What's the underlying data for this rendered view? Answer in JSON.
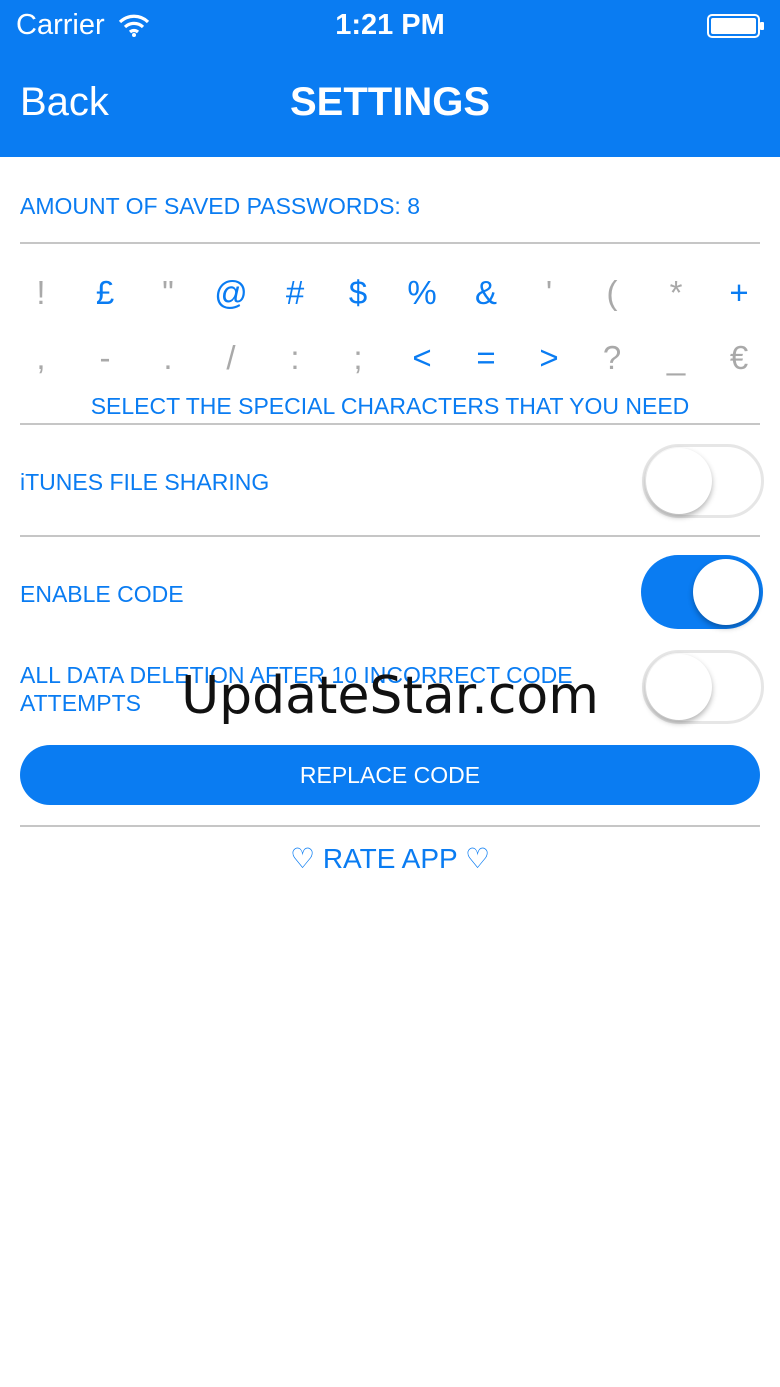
{
  "status_bar": {
    "carrier": "Carrier",
    "time": "1:21 PM",
    "icons": [
      "wifi-icon",
      "battery-icon"
    ]
  },
  "nav": {
    "back_label": "Back",
    "title": "SETTINGS"
  },
  "saved_passwords_label": "AMOUNT OF SAVED PASSWORDS: 8",
  "special_characters": {
    "row1": [
      {
        "char": "!",
        "selected": false
      },
      {
        "char": "£",
        "selected": true
      },
      {
        "char": "\"",
        "selected": false
      },
      {
        "char": "@",
        "selected": true
      },
      {
        "char": "#",
        "selected": true
      },
      {
        "char": "$",
        "selected": true
      },
      {
        "char": "%",
        "selected": true
      },
      {
        "char": "&",
        "selected": true
      },
      {
        "char": "'",
        "selected": false
      },
      {
        "char": "(",
        "selected": false
      },
      {
        "char": "*",
        "selected": false
      },
      {
        "char": "+",
        "selected": true
      }
    ],
    "row2": [
      {
        "char": ",",
        "selected": false
      },
      {
        "char": "-",
        "selected": false
      },
      {
        "char": ".",
        "selected": false
      },
      {
        "char": "/",
        "selected": false
      },
      {
        "char": ":",
        "selected": false
      },
      {
        "char": ";",
        "selected": false
      },
      {
        "char": "<",
        "selected": true
      },
      {
        "char": "=",
        "selected": true
      },
      {
        "char": ">",
        "selected": true
      },
      {
        "char": "?",
        "selected": false
      },
      {
        "char": "_",
        "selected": false
      },
      {
        "char": "€",
        "selected": false
      }
    ],
    "caption": "SELECT THE SPECIAL CHARACTERS THAT YOU NEED"
  },
  "itunes_sharing": {
    "label": "iTUNES FILE SHARING",
    "enabled": false
  },
  "enable_code": {
    "label": "ENABLE CODE",
    "enabled": true
  },
  "data_deletion": {
    "label_line1": "ALL DATA DELETION AFTER 10 INCORRECT CODE",
    "label_line2": "ATTEMPTS",
    "enabled": false
  },
  "replace_code_label": "REPLACE CODE",
  "rate_app_label": "♡ RATE APP ♡",
  "watermark": "UpdateStar.com",
  "colors": {
    "accent": "#0a7cf2",
    "divider": "#c6c6c6",
    "inactive_char": "#a9a9a9"
  }
}
